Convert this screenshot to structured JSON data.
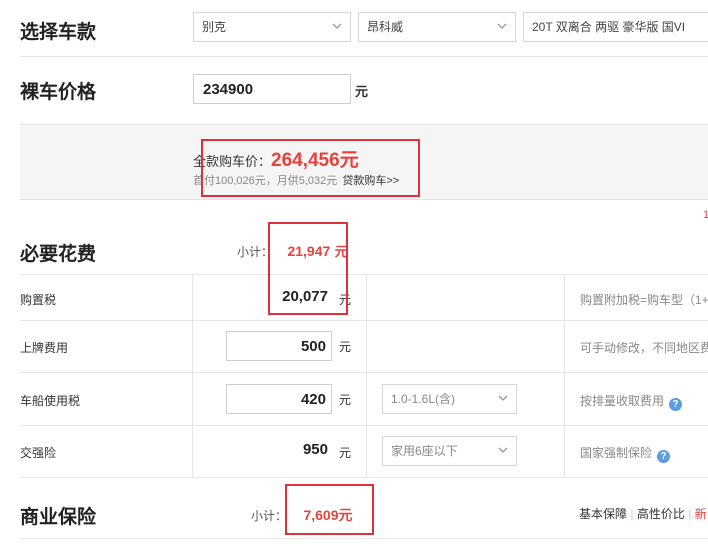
{
  "select_model": {
    "title": "选择车款",
    "brand": "别克",
    "series": "昂科威",
    "trim": "20T 双离合 两驱 豪华版 国VI"
  },
  "bare_price": {
    "title": "裸车价格",
    "value": "234900",
    "unit": "元"
  },
  "total": {
    "label": "全款购车价：",
    "value": "264,456元",
    "detail": "首付100,026元，月供5,032元",
    "loan_link": "贷款购车>>",
    "edge_fragment": "1"
  },
  "required": {
    "title": "必要花费",
    "subtotal_label": "小计：",
    "subtotal_value": "21,947",
    "subtotal_unit": "元",
    "rows": [
      {
        "label": "购置税",
        "value": "20,077",
        "unit": "元",
        "note": "购置附加税=购车型（1+"
      },
      {
        "label": "上牌费用",
        "value": "500",
        "unit": "元",
        "note": "可手动修改，不同地区费"
      },
      {
        "label": "车船使用税",
        "value": "420",
        "unit": "元",
        "option": "1.0-1.6L(含)",
        "note": "按排量收取费用"
      },
      {
        "label": "交强险",
        "value": "950",
        "unit": "元",
        "option": "家用6座以下",
        "note": "国家强制保险"
      }
    ]
  },
  "insurance": {
    "title": "商业保险",
    "subtotal_label": "小计：",
    "subtotal_value": "7,609元",
    "plans": [
      "基本保障",
      "高性价比",
      "新"
    ]
  },
  "colors": {
    "accent_red": "#e8423e",
    "box_red": "#e0313a",
    "help_blue": "#5a9de0"
  }
}
